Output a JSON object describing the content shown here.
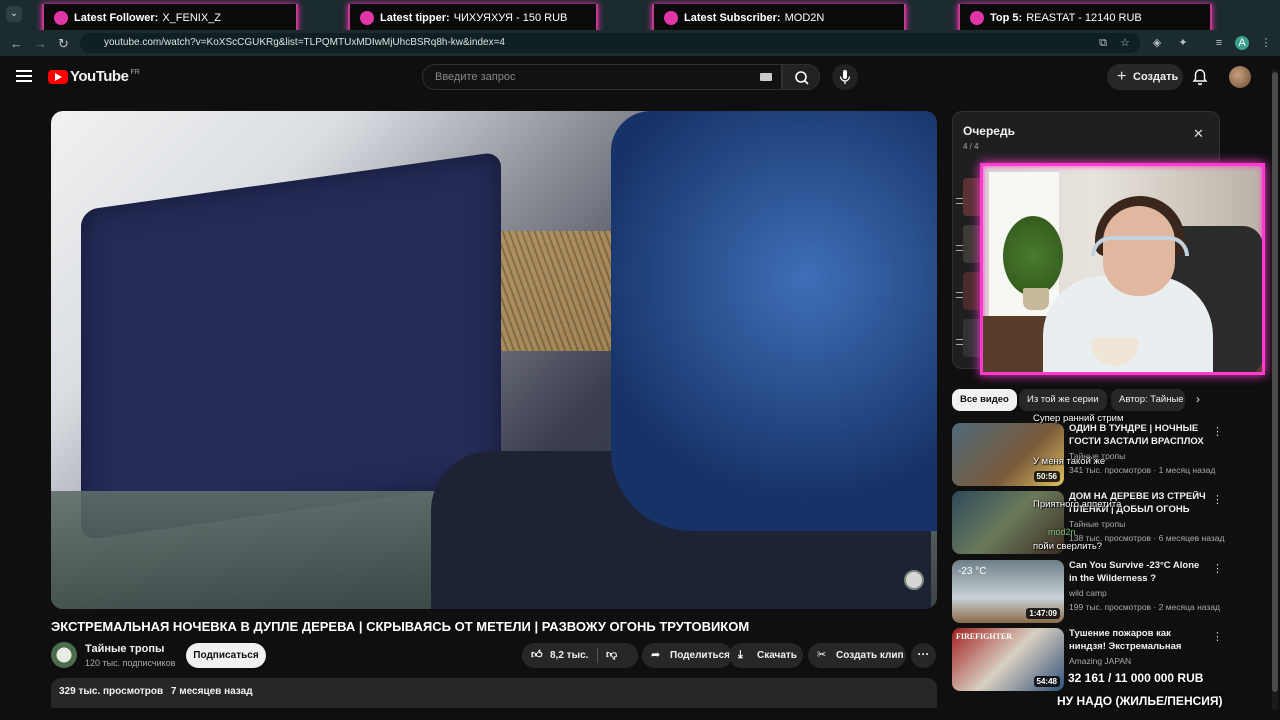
{
  "overlay": {
    "latest_follower": {
      "label": "Latest Follower:",
      "value": "X_FENIX_Z"
    },
    "latest_tipper": {
      "label": "Latest tipper:",
      "value": "ЧИХУЯХУЯ - 150 RUB"
    },
    "latest_subscriber": {
      "label": "Latest Subscriber:",
      "value": "MOD2N"
    },
    "top5": {
      "label": "Top 5:",
      "value": "REASTAT - 12140 RUB"
    },
    "goal_amount": "32 161 / 11 000 000 RUB",
    "goal_name": "НУ НАДО (ЖИЛЬЕ/ПЕНСИЯ)"
  },
  "browser": {
    "url": "youtube.com/watch?v=KoXScCGUKRg&list=TLPQMTUxMDIwMjUhcBSRq8h-kw&index=4",
    "profile_initial": "A"
  },
  "header": {
    "logo_text": "YouTube",
    "logo_region": "FR",
    "search_placeholder": "Введите запрос",
    "create_label": "Создать"
  },
  "video": {
    "title": "ЭКСТРЕМАЛЬНАЯ НОЧЕВКА В ДУПЛЕ ДЕРЕВА | СКРЫВАЯСЬ ОТ МЕТЕЛИ | РАЗВОЖУ ОГОНЬ ТРУТОВИКОМ",
    "channel": "Тайные тропы",
    "subscribers": "120 тыс. подписчиков",
    "subscribe_label": "Подписаться",
    "likes": "8,2 тыс.",
    "share_label": "Поделиться",
    "download_label": "Скачать",
    "clip_label": "Создать клип",
    "more_label": "···",
    "views": "329 тыс. просмотров",
    "age": "7 месяцев назад"
  },
  "queue": {
    "title": "Очередь",
    "count": "4 / 4",
    "close": "✕"
  },
  "chips": [
    "Все видео",
    "Из той же серии",
    "Автор: Тайные тропы"
  ],
  "recommendations": [
    {
      "title": "ОДИН В ТУНДРЕ | НОЧНЫЕ ГОСТИ ЗАСТАЛИ ВРАСПЛОХ ...",
      "channel": "Тайные тропы",
      "meta": "341 тыс. просмотров · 1 месяц назад",
      "duration": "50:56"
    },
    {
      "title": "ДОМ НА ДЕРЕВЕ ИЗ СТРЕЙЧ ПЛЕНКИ | ДОБЫЛ ОГОНЬ БЕ...",
      "channel": "Тайные тропы",
      "meta": "138 тыс. просмотров · 6 месяцев назад",
      "duration": ""
    },
    {
      "title": "Can You Survive -23°C Alone in the Wilderness ?",
      "channel": "wild camp",
      "meta": "199 тыс. просмотров · 2 месяца назад",
      "duration": "1:47:09",
      "thumb_text": "-23 °C"
    },
    {
      "title": "Тушение пожаров как ниндзя! Экстремальная дисциплина ...",
      "channel": "Amazing JAPAN",
      "meta": "",
      "duration": "54:48",
      "thumb_text": "FIREFIGHTER"
    }
  ],
  "chat": {
    "messages": [
      "Супер ранний стрим",
      "У меня такой же",
      "Приятного аппетита",
      "пойи сверлить?"
    ],
    "user": "mod2n"
  },
  "colors": {
    "accent": "#ff0000",
    "overlay_pink": "#ff3ad1",
    "overlay_cyan": "#29e0d0"
  }
}
